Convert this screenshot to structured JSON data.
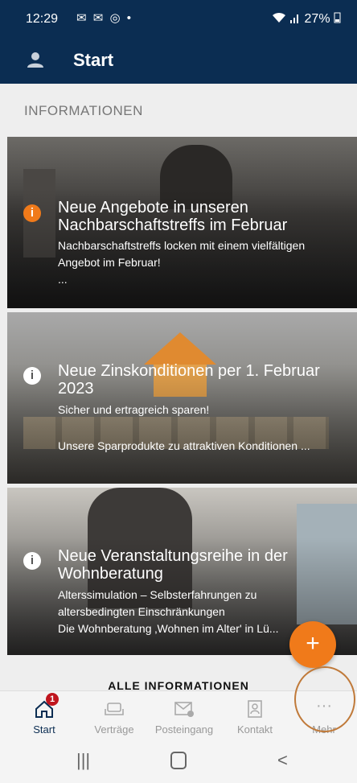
{
  "statusbar": {
    "time": "12:29",
    "notif_icons": "✉ ✉ ◎ •",
    "battery": "27%"
  },
  "appbar": {
    "title": "Start"
  },
  "section_title": "INFORMATIONEN",
  "cards": [
    {
      "headline": "Neue Angebote in unseren Nachbarschaftstreffs im Februar",
      "sub1": "Nachbarschaftstreffs locken mit einem vielfältigen",
      "sub2": "Angebot im Februar!",
      "sub3": "...",
      "badge": "i",
      "badge_color": "#f07a1a"
    },
    {
      "headline": "Neue Zinskonditionen per 1. Februar 2023",
      "sub1": "Sicher und ertragreich sparen!",
      "sub2": "Unsere Sparprodukte zu attraktiven Konditionen ...",
      "badge": "i"
    },
    {
      "headline": "Neue Veranstaltungsreihe in der Wohnberatung",
      "sub1": "Alterssimulation – Selbsterfahrungen zu",
      "sub2": "altersbedingten Einschränkungen",
      "sub3": "Die Wohnberatung ‚Wohnen im Alter' in Lü...",
      "badge": "i"
    }
  ],
  "all_info_label": "ALLE INFORMATIONEN",
  "fab_label": "+",
  "bottom_nav": {
    "start": {
      "label": "Start",
      "badge": "1"
    },
    "vertraege": {
      "label": "Verträge"
    },
    "posteingang": {
      "label": "Posteingang"
    },
    "kontakt": {
      "label": "Kontakt"
    },
    "mehr": {
      "label": "Mehr",
      "icon_text": "···"
    }
  },
  "colors": {
    "primary": "#0b2d52",
    "accent": "#f07a1a",
    "badge": "#c0151e"
  }
}
